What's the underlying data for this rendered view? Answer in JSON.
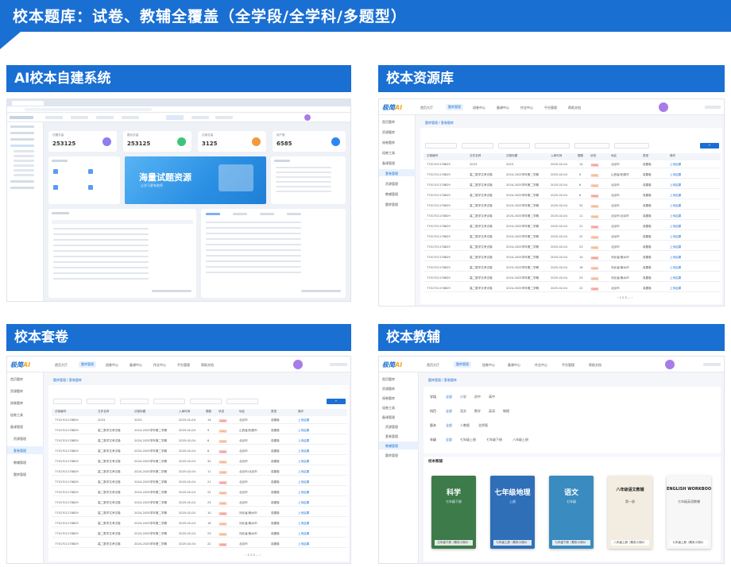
{
  "header": {
    "title": "校本题库：试卷、教辅全覆盖（全学段/全学科/多题型）"
  },
  "sections": {
    "ai": "AI校本自建系统",
    "resource": "校本资源库",
    "paper": "校本套卷",
    "tutor": "校本教辅"
  },
  "brand": {
    "logo_text": "极简",
    "logo_ai": "AI",
    "accent": "#1a6fd3",
    "logo_accent": "#f5a623"
  },
  "ai_system": {
    "stats": [
      {
        "label": "试题总量",
        "value": "253125",
        "color": "#8e7cf0"
      },
      {
        "label": "题目总量",
        "value": "253125",
        "color": "#3ec47a"
      },
      {
        "label": "试卷总量",
        "value": "3125",
        "color": "#f39a3d"
      },
      {
        "label": "用户数",
        "value": "6585",
        "color": "#2f86f0"
      }
    ],
    "banner_title": "海量试题资源",
    "banner_sub": "让学习更有效率"
  },
  "resource_nav": {
    "tabs": [
      "首页大厅",
      "题库管理",
      "组卷中心",
      "备课中心",
      "作业中心",
      "平台管理",
      "帮助文档"
    ],
    "side": [
      "首页题库",
      "资源题库",
      "阅卷题库",
      "组卷工具",
      "备课管理",
      "资源管理",
      "套卷管理",
      "教辅管理",
      "题库管理"
    ],
    "breadcrumb": "题库管理 / 套卷题库",
    "columns": [
      "试卷编号",
      "文件名称",
      "试卷标题",
      "入库时间",
      "题数",
      "状态",
      "地区",
      "类型",
      "操作"
    ],
    "rows": [
      [
        "7701701178829",
        "2023",
        "2023",
        "2025-02-04",
        "14",
        "待审核",
        "北京市",
        "真题卷",
        "上传结果"
      ],
      [
        "7701701178829",
        "高二数学文考试卷",
        "2024-2025学年第二学期",
        "2025-02-04",
        "9",
        "待审核",
        "山西省/阳泉市",
        "真题卷",
        "上传结果"
      ],
      [
        "7701701178829",
        "高二数学文考试卷",
        "2024-2025学年第二学期",
        "2025-02-04",
        "6",
        "待审核",
        "北京市",
        "真题卷",
        "上传结果"
      ],
      [
        "7701701178829",
        "高二数学文考试卷",
        "2024-2025学年第二学期",
        "2025-02-04",
        "6",
        "待审核",
        "北京市",
        "真题卷",
        "上传结果"
      ],
      [
        "7701701178829",
        "高二数学文考试卷",
        "2024-2025学年第二学期",
        "2025-02-04",
        "32",
        "待审核",
        "北京市",
        "真题卷",
        "上传结果"
      ],
      [
        "7701701178829",
        "高二数学文考试卷",
        "2024-2025学年第二学期",
        "2025-02-04",
        "11",
        "待审核",
        "北京市/北京市",
        "真题卷",
        "上传结果"
      ],
      [
        "7701701178829",
        "高二数学文考试卷",
        "2024-2025学年第二学期",
        "2025-02-04",
        "21",
        "待审核",
        "北京市",
        "真题卷",
        "上传结果"
      ],
      [
        "7701701178829",
        "高二数学文考试卷",
        "2024-2025学年第二学期",
        "2025-02-04",
        "22",
        "待审核",
        "北京市",
        "真题卷",
        "上传结果"
      ],
      [
        "7701701178829",
        "高二数学文考试卷",
        "2024-2025学年第二学期",
        "2025-02-04",
        "23",
        "待审核",
        "北京市",
        "真题卷",
        "上传结果"
      ],
      [
        "7701701178829",
        "高二数学文考试卷",
        "2024-2025学年第二学期",
        "2025-02-04",
        "10",
        "待审核",
        "河北省/衡水市",
        "真题卷",
        "上传结果"
      ],
      [
        "7701701178829",
        "高二数学文考试卷",
        "2024-2025学年第二学期",
        "2025-02-04",
        "16",
        "待审核",
        "河北省/衡水市",
        "真题卷",
        "上传结果"
      ],
      [
        "7701701178829",
        "高二数学文考试卷",
        "2024-2025学年第二学期",
        "2025-02-04",
        "23",
        "待审核",
        "河北省/衡水市",
        "真题卷",
        "上传结果"
      ],
      [
        "7701701178829",
        "高二数学文考试卷",
        "2024-2025学年第二学期",
        "2025-02-04",
        "22",
        "待审核",
        "北京市",
        "真题卷",
        "上传结果"
      ]
    ]
  },
  "tutor": {
    "filters": [
      {
        "label": "学段",
        "options": [
          "全部",
          "小学",
          "初中",
          "高中"
        ]
      },
      {
        "label": "科目",
        "options": [
          "全部",
          "语文",
          "数学",
          "英语",
          "物理"
        ]
      },
      {
        "label": "版本",
        "options": [
          "全部",
          "人教版",
          "北师版"
        ]
      },
      {
        "label": "年级",
        "options": [
          "全部",
          "七年级上册",
          "七年级下册",
          "八年级上册"
        ]
      }
    ],
    "list_title": "校本教辅",
    "books": [
      {
        "title": "科学",
        "sub": "七年级下册",
        "caption": "五年级下册（期末小测A）",
        "bg": "#3d7b4a"
      },
      {
        "title": "七年级地理",
        "sub": "上册",
        "caption": "七年级上册（期末小测A）",
        "bg": "#2f6fb8"
      },
      {
        "title": "语文",
        "sub": "七年级",
        "caption": "七年级下册（期末小测A）",
        "bg": "#3a8bbf"
      },
      {
        "title": "八年级语文教辅",
        "sub": "第一册",
        "caption": "八年级上册（期末小测A）",
        "bg": "#f2ede0"
      },
      {
        "title": "ENGLISH WORKBOOK",
        "sub": "七年级英语教辅",
        "caption": "七年级上册（期末小测A）",
        "bg": "#f7f7f7"
      }
    ]
  }
}
